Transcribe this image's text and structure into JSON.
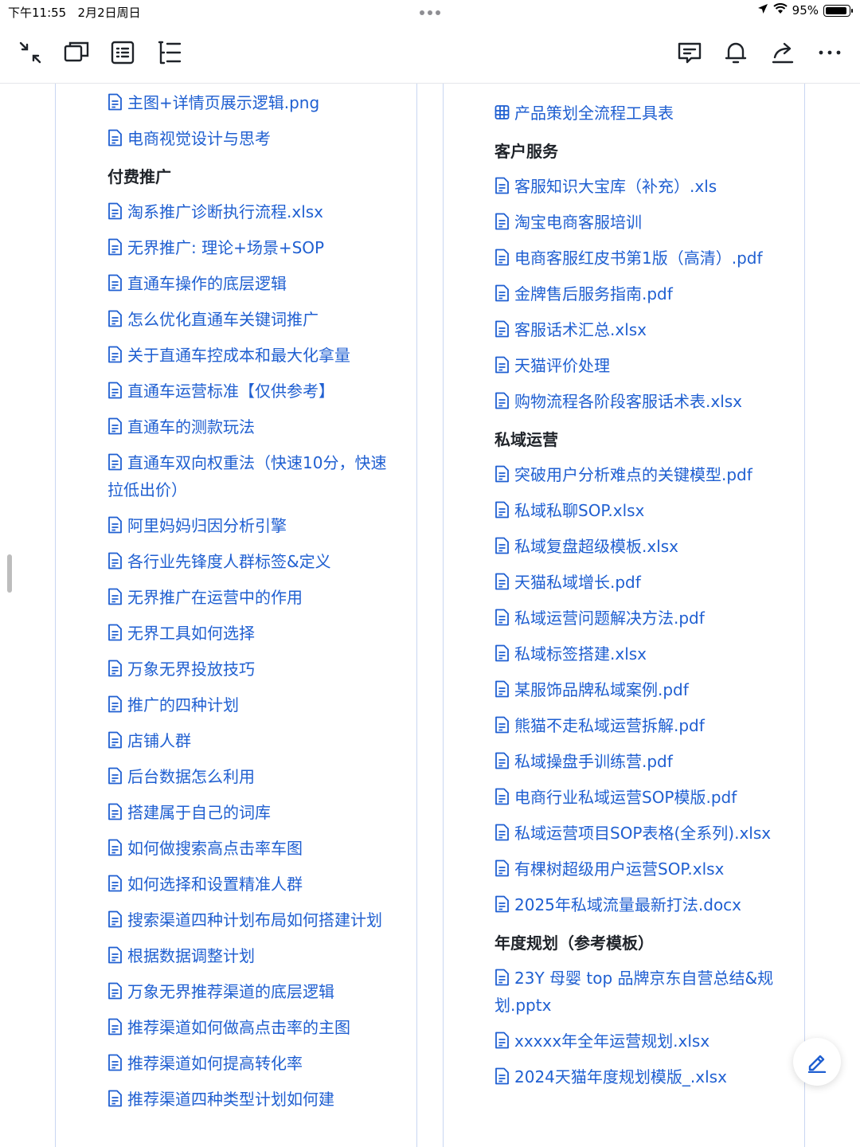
{
  "status_bar": {
    "time": "下午11:55",
    "date": "2月2日周日",
    "battery": "95%"
  },
  "toolbar": {
    "left_icons": [
      "collapse-icon",
      "window-icon",
      "outline-icon",
      "directory-icon"
    ],
    "right_icons": [
      "comment-icon",
      "bell-icon",
      "share-icon",
      "more-icon"
    ]
  },
  "left_column": {
    "items": [
      {
        "type": "link",
        "icon": "doc-icon",
        "text": "主图+详情页展示逻辑.png"
      },
      {
        "type": "link",
        "icon": "doc-icon",
        "text": "电商视觉设计与思考"
      },
      {
        "type": "heading",
        "text": "付费推广"
      },
      {
        "type": "link",
        "icon": "doc-icon",
        "text": "淘系推广诊断执行流程.xlsx"
      },
      {
        "type": "link",
        "icon": "doc-icon",
        "text": "无界推广: 理论+场景+SOP"
      },
      {
        "type": "link",
        "icon": "doc-icon",
        "text": "直通车操作的底层逻辑"
      },
      {
        "type": "link",
        "icon": "doc-icon",
        "text": "怎么优化直通车关键词推广"
      },
      {
        "type": "link",
        "icon": "doc-icon",
        "text": "关于直通车控成本和最大化拿量"
      },
      {
        "type": "link",
        "icon": "doc-icon",
        "text": "直通车运营标准【仅供参考】"
      },
      {
        "type": "link",
        "icon": "doc-icon",
        "text": "直通车的测款玩法"
      },
      {
        "type": "link",
        "icon": "doc-icon",
        "text": "直通车双向权重法（快速10分，快速拉低出价）"
      },
      {
        "type": "link",
        "icon": "doc-icon",
        "text": "阿里妈妈归因分析引擎"
      },
      {
        "type": "link",
        "icon": "doc-icon",
        "text": "各行业先锋度人群标签&定义"
      },
      {
        "type": "link",
        "icon": "doc-icon",
        "text": "无界推广在运营中的作用"
      },
      {
        "type": "link",
        "icon": "doc-icon",
        "text": "无界工具如何选择"
      },
      {
        "type": "link",
        "icon": "doc-icon",
        "text": "万象无界投放技巧"
      },
      {
        "type": "link",
        "icon": "doc-icon",
        "text": "推广的四种计划"
      },
      {
        "type": "link",
        "icon": "doc-icon",
        "text": "店铺人群"
      },
      {
        "type": "link",
        "icon": "doc-icon",
        "text": "后台数据怎么利用"
      },
      {
        "type": "link",
        "icon": "doc-icon",
        "text": "搭建属于自己的词库"
      },
      {
        "type": "link",
        "icon": "doc-icon",
        "text": "如何做搜索高点击率车图"
      },
      {
        "type": "link",
        "icon": "doc-icon",
        "text": "如何选择和设置精准人群"
      },
      {
        "type": "link",
        "icon": "doc-icon",
        "text": "搜索渠道四种计划布局如何搭建计划"
      },
      {
        "type": "link",
        "icon": "doc-icon",
        "text": "根据数据调整计划"
      },
      {
        "type": "link",
        "icon": "doc-icon",
        "text": "万象无界推荐渠道的底层逻辑"
      },
      {
        "type": "link",
        "icon": "doc-icon",
        "text": "推荐渠道如何做高点击率的主图"
      },
      {
        "type": "link",
        "icon": "doc-icon",
        "text": "推荐渠道如何提高转化率"
      },
      {
        "type": "link",
        "icon": "doc-icon",
        "text": "推荐渠道四种类型计划如何建"
      }
    ]
  },
  "right_column": {
    "items": [
      {
        "type": "link",
        "icon": "table-icon",
        "text": "产品策划全流程工具表"
      },
      {
        "type": "heading",
        "text": "客户服务"
      },
      {
        "type": "link",
        "icon": "doc-icon",
        "text": "客服知识大宝库（补充）.xls"
      },
      {
        "type": "link",
        "icon": "doc-icon",
        "text": "淘宝电商客服培训"
      },
      {
        "type": "link",
        "icon": "doc-icon",
        "text": "电商客服红皮书第1版（高清）.pdf"
      },
      {
        "type": "link",
        "icon": "doc-icon",
        "text": "金牌售后服务指南.pdf"
      },
      {
        "type": "link",
        "icon": "doc-icon",
        "text": "客服话术汇总.xlsx"
      },
      {
        "type": "link",
        "icon": "doc-icon",
        "text": "天猫评价处理"
      },
      {
        "type": "link",
        "icon": "doc-icon",
        "text": "购物流程各阶段客服话术表.xlsx"
      },
      {
        "type": "heading",
        "text": "私域运营"
      },
      {
        "type": "link",
        "icon": "doc-icon",
        "text": "突破用户分析难点的关键模型.pdf"
      },
      {
        "type": "link",
        "icon": "doc-icon",
        "text": "私域私聊SOP.xlsx"
      },
      {
        "type": "link",
        "icon": "doc-icon",
        "text": "私域复盘超级模板.xlsx"
      },
      {
        "type": "link",
        "icon": "doc-icon",
        "text": "天猫私域增长.pdf"
      },
      {
        "type": "link",
        "icon": "doc-icon",
        "text": "私域运营问题解决方法.pdf"
      },
      {
        "type": "link",
        "icon": "doc-icon",
        "text": "私域标签搭建.xlsx"
      },
      {
        "type": "link",
        "icon": "doc-icon",
        "text": "某服饰品牌私域案例.pdf"
      },
      {
        "type": "link",
        "icon": "doc-icon",
        "text": "熊猫不走私域运营拆解.pdf"
      },
      {
        "type": "link",
        "icon": "doc-icon",
        "text": "私域操盘手训练营.pdf"
      },
      {
        "type": "link",
        "icon": "doc-icon",
        "text": "电商行业私域运营SOP模版.pdf"
      },
      {
        "type": "link",
        "icon": "doc-icon",
        "text": "私域运营项目SOP表格(全系列).xlsx"
      },
      {
        "type": "link",
        "icon": "doc-icon",
        "text": "有棵树超级用户运营SOP.xlsx"
      },
      {
        "type": "link",
        "icon": "doc-icon",
        "text": "2025年私域流量最新打法.docx"
      },
      {
        "type": "heading",
        "text": "年度规划（参考模板）"
      },
      {
        "type": "link",
        "icon": "doc-icon",
        "text": "23Y 母婴 top 品牌京东自营总结&规划.pptx"
      },
      {
        "type": "link",
        "icon": "doc-icon",
        "text": "xxxxx年全年运营规划.xlsx"
      },
      {
        "type": "link",
        "icon": "doc-icon",
        "text": "2024天猫年度规划模版_.xlsx"
      }
    ]
  },
  "colors": {
    "link": "#1f5fd1",
    "heading": "#1f2329",
    "column_border": "#c9d6f2"
  }
}
